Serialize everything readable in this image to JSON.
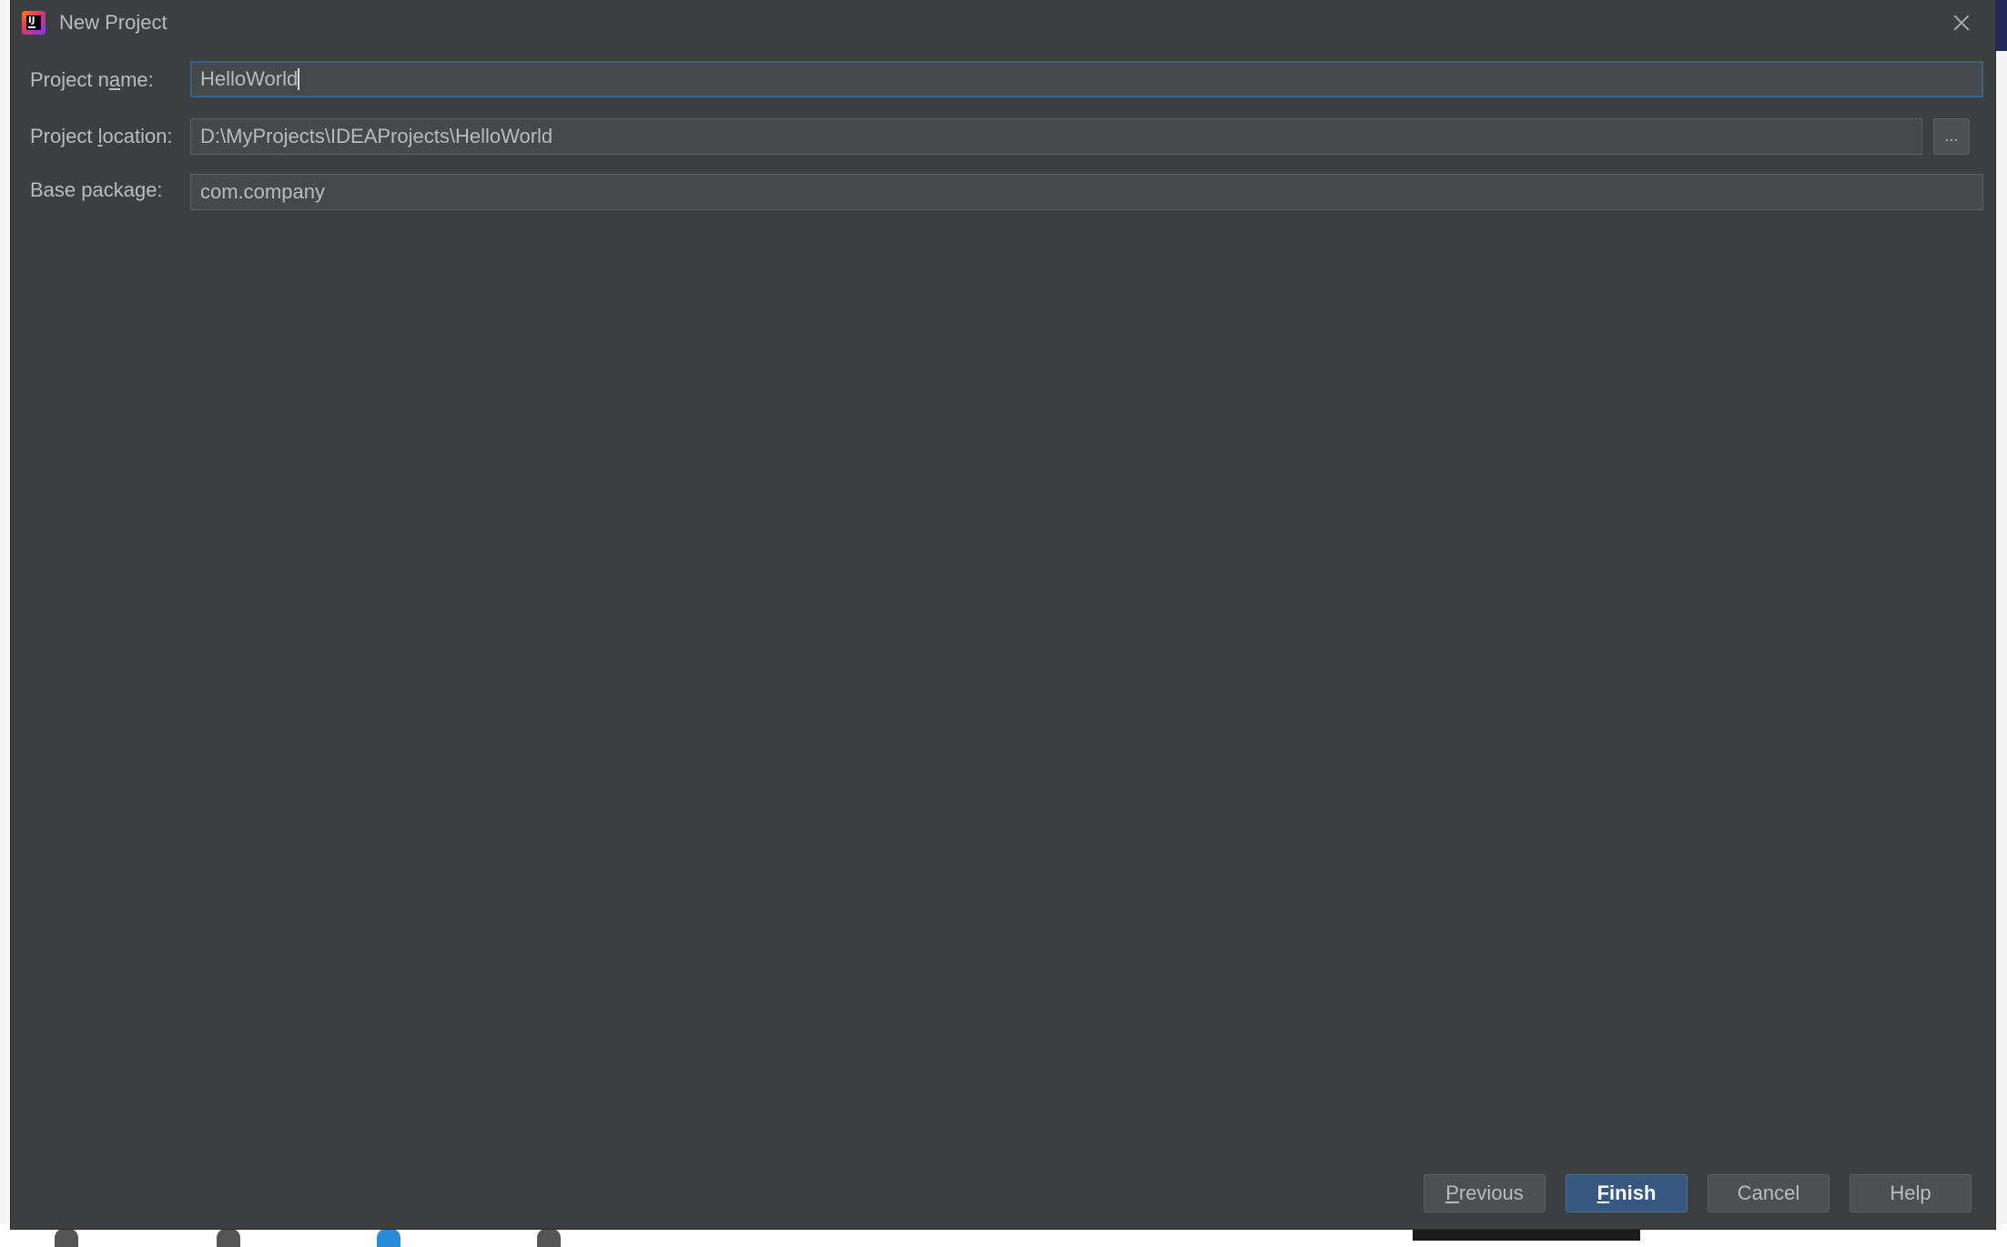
{
  "window": {
    "title": "New Project"
  },
  "form": {
    "project_name": {
      "label_pre": "Project n",
      "label_mnemonic": "a",
      "label_post": "me:",
      "value": "HelloWorld"
    },
    "project_location": {
      "label_pre": "Project ",
      "label_mnemonic": "l",
      "label_post": "ocation:",
      "value": "D:\\MyProjects\\IDEAProjects\\HelloWorld",
      "browse_label": "..."
    },
    "base_package": {
      "label": "Base package:",
      "value": "com.company"
    }
  },
  "buttons": {
    "previous": {
      "mnemonic": "P",
      "rest": "revious"
    },
    "finish": {
      "mnemonic": "F",
      "rest": "inish"
    },
    "cancel": "Cancel",
    "help": "Help"
  },
  "colors": {
    "dialog_bg": "#3c3f41",
    "field_bg": "#45494a",
    "focus_border": "#3d6185",
    "primary_button": "#365880",
    "text": "#bbbbbb"
  },
  "icons": {
    "app": "intellij-idea-icon",
    "close": "close-icon"
  }
}
